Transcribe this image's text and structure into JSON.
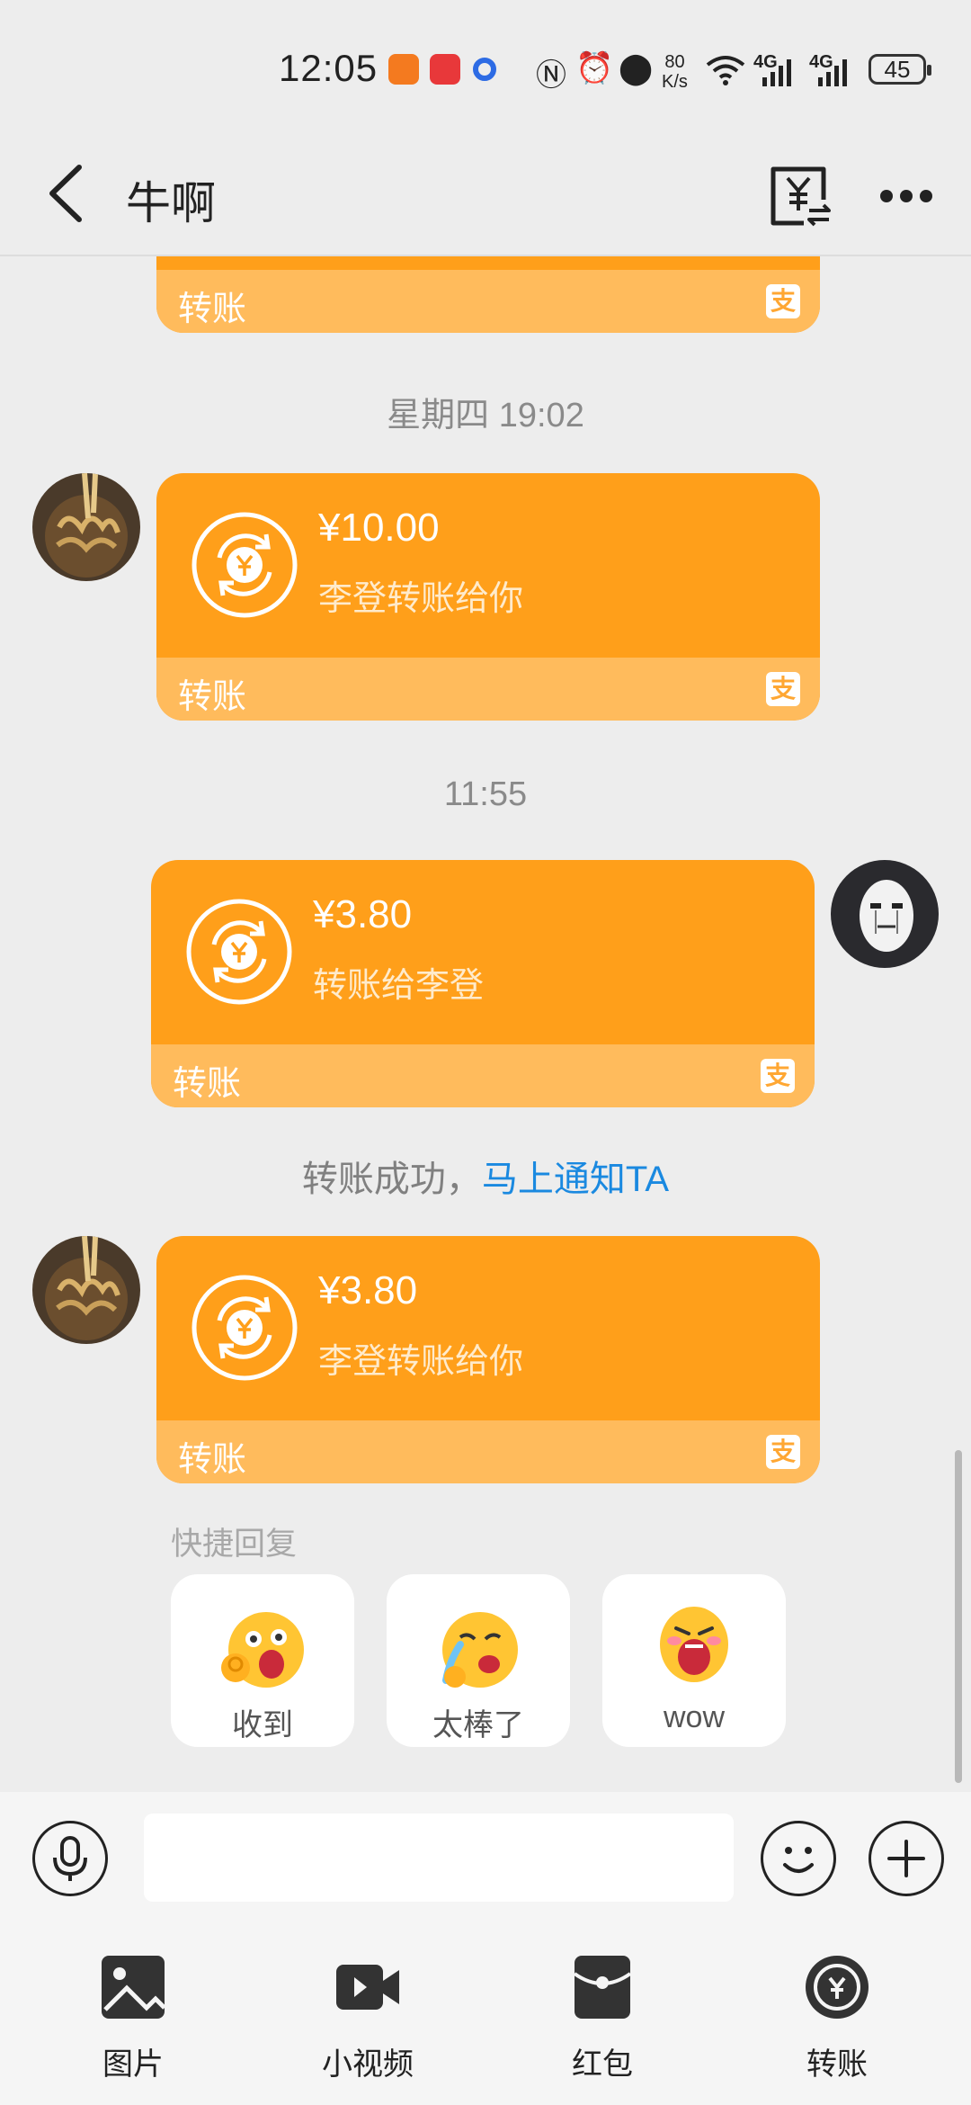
{
  "status_bar": {
    "time": "12:05",
    "net_speed_top": "80",
    "net_speed_bottom": "K/s",
    "signal1": "4G",
    "signal2": "4G",
    "battery": "45"
  },
  "header": {
    "title": "牛啊"
  },
  "messages": [
    {
      "type": "transfer",
      "side": "left",
      "amount": "",
      "desc": "",
      "footer": "转账",
      "alipay": "支"
    },
    {
      "type": "time",
      "text": "星期四 19:02"
    },
    {
      "type": "transfer",
      "side": "left",
      "amount": "¥10.00",
      "desc": "李登转账给你",
      "footer": "转账",
      "alipay": "支"
    },
    {
      "type": "time",
      "text": "11:55"
    },
    {
      "type": "transfer",
      "side": "right",
      "amount": "¥3.80",
      "desc": "转账给李登",
      "footer": "转账",
      "alipay": "支"
    },
    {
      "type": "notice",
      "text": "转账成功，",
      "link": "马上通知TA"
    },
    {
      "type": "transfer",
      "side": "left",
      "amount": "¥3.80",
      "desc": "李登转账给你",
      "footer": "转账",
      "alipay": "支"
    }
  ],
  "quick_reply": {
    "label": "快捷回复",
    "items": [
      {
        "label": "收到",
        "icon": "ok-emoji"
      },
      {
        "label": "太棒了",
        "icon": "crying-laugh-emoji"
      },
      {
        "label": "wow",
        "icon": "shouting-emoji"
      }
    ]
  },
  "input": {
    "placeholder": ""
  },
  "toolbar": [
    {
      "label": "图片",
      "icon": "image-icon"
    },
    {
      "label": "小视频",
      "icon": "video-icon"
    },
    {
      "label": "红包",
      "icon": "red-packet-icon"
    },
    {
      "label": "转账",
      "icon": "transfer-icon"
    }
  ],
  "colors": {
    "card": "#FF9F1A",
    "card_footer": "#FFBB5C",
    "link": "#1A89E0",
    "background": "#EDEDED"
  }
}
